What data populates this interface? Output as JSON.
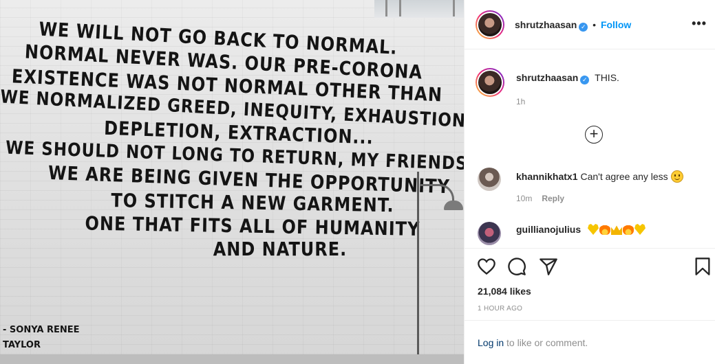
{
  "post": {
    "mural_lines": [
      "WE WILL NOT GO BACK TO NORMAL.",
      "NORMAL NEVER WAS.  OUR PRE-CORONA",
      "EXISTENCE WAS NOT NORMAL OTHER THAN",
      "WE NORMALIZED GREED, INEQUITY, EXHAUSTION,",
      "DEPLETION, EXTRACTION...",
      "WE SHOULD NOT LONG TO RETURN, MY FRIENDS.",
      "WE ARE BEING GIVEN THE OPPORTUNITY",
      "TO STITCH A NEW GARMENT.",
      "ONE THAT FITS ALL OF HUMANITY",
      "AND NATURE."
    ],
    "attribution": [
      "- SONYA RENEE",
      "TAYLOR"
    ]
  },
  "header": {
    "username": "shrutzhaasan",
    "separator": "•",
    "follow_label": "Follow",
    "more_label": "•••",
    "verified_icon": "check-badge-icon"
  },
  "caption": {
    "username": "shrutzhaasan",
    "text": "THIS.",
    "time": "1h"
  },
  "load_more_label": "+",
  "comments": [
    {
      "username": "khannikhatx1",
      "text": "Can't agree any less",
      "emoji": "slightly-smiling-face",
      "time": "10m",
      "reply_label": "Reply"
    },
    {
      "username": "guillianojulius",
      "emoji": [
        "yellow-heart",
        "fire",
        "crown",
        "fire",
        "yellow-heart"
      ]
    }
  ],
  "actions": {
    "icons": [
      "heart-icon",
      "comment-icon",
      "share-icon",
      "bookmark-icon"
    ],
    "likes": "21,084 likes",
    "posted_ago": "1 HOUR AGO"
  },
  "login_bar": {
    "link": "Log in",
    "text": " to like or comment."
  },
  "colors": {
    "link_blue": "#0095f6",
    "verified_blue": "#3897f0",
    "muted_gray": "#8e8e8e",
    "text": "#262626",
    "border": "#efefef"
  }
}
